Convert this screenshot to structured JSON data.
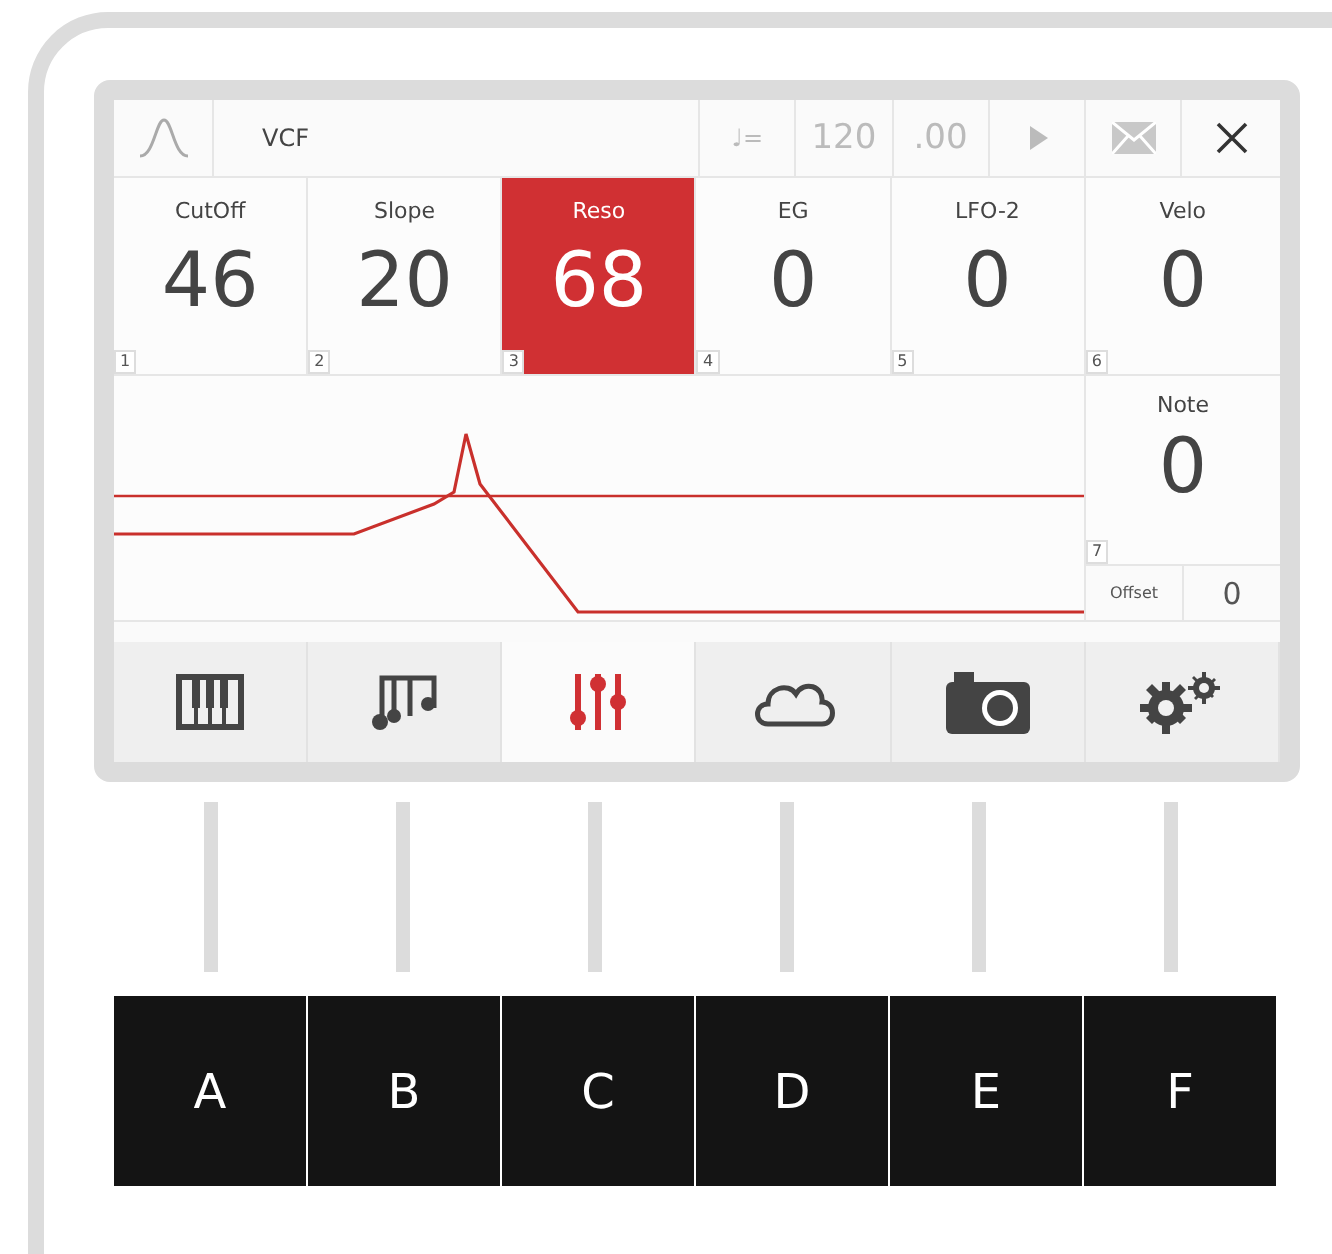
{
  "header": {
    "title": "VCF",
    "tempo_label": "♩=",
    "tempo": "120",
    "tempo_fraction": ".00"
  },
  "params": [
    {
      "label": "CutOff",
      "value": "46",
      "index": "1",
      "selected": false
    },
    {
      "label": "Slope",
      "value": "20",
      "index": "2",
      "selected": false
    },
    {
      "label": "Reso",
      "value": "68",
      "index": "3",
      "selected": true
    },
    {
      "label": "EG",
      "value": "0",
      "index": "4",
      "selected": false
    },
    {
      "label": "LFO-2",
      "value": "0",
      "index": "5",
      "selected": false
    },
    {
      "label": "Velo",
      "value": "0",
      "index": "6",
      "selected": false
    }
  ],
  "note": {
    "label": "Note",
    "value": "0",
    "index": "7"
  },
  "offset": {
    "label": "Offset",
    "value": "0"
  },
  "tabs": [
    {
      "kind": "piano",
      "selected": false
    },
    {
      "kind": "notes",
      "selected": false
    },
    {
      "kind": "sliders",
      "selected": true
    },
    {
      "kind": "cloud",
      "selected": false
    },
    {
      "kind": "camera",
      "selected": false
    },
    {
      "kind": "gears",
      "selected": false
    }
  ],
  "callouts": [
    "A",
    "B",
    "C",
    "D",
    "E",
    "F"
  ]
}
